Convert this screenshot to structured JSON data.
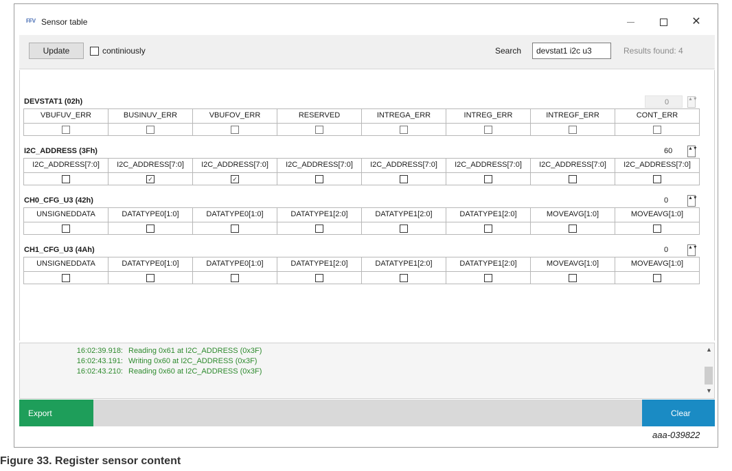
{
  "window": {
    "title": "Sensor table",
    "app_icon_text": "FFV"
  },
  "toolbar": {
    "update_label": "Update",
    "continuously_label": "continiously",
    "search_label": "Search",
    "search_value": "devstat1 i2c u3",
    "results_text": "Results found: 4"
  },
  "registers": [
    {
      "name": "DEVSTAT1 (02h)",
      "value": "0",
      "disabled": true,
      "bits": [
        "VBUFUV_ERR",
        "BUSINUV_ERR",
        "VBUFOV_ERR",
        "RESERVED",
        "INTREGA_ERR",
        "INTREG_ERR",
        "INTREGF_ERR",
        "CONT_ERR"
      ],
      "checked": [
        false,
        false,
        false,
        false,
        false,
        false,
        false,
        false
      ]
    },
    {
      "name": "I2C_ADDRESS (3Fh)",
      "value": "60",
      "disabled": false,
      "bits": [
        "I2C_ADDRESS[7:0]",
        "I2C_ADDRESS[7:0]",
        "I2C_ADDRESS[7:0]",
        "I2C_ADDRESS[7:0]",
        "I2C_ADDRESS[7:0]",
        "I2C_ADDRESS[7:0]",
        "I2C_ADDRESS[7:0]",
        "I2C_ADDRESS[7:0]"
      ],
      "checked": [
        false,
        true,
        true,
        false,
        false,
        false,
        false,
        false
      ]
    },
    {
      "name": "CH0_CFG_U3 (42h)",
      "value": "0",
      "disabled": false,
      "bits": [
        "UNSIGNEDDATA",
        "DATATYPE0[1:0]",
        "DATATYPE0[1:0]",
        "DATATYPE1[2:0]",
        "DATATYPE1[2:0]",
        "DATATYPE1[2:0]",
        "MOVEAVG[1:0]",
        "MOVEAVG[1:0]"
      ],
      "checked": [
        false,
        false,
        false,
        false,
        false,
        false,
        false,
        false
      ]
    },
    {
      "name": "CH1_CFG_U3 (4Ah)",
      "value": "0",
      "disabled": false,
      "bits": [
        "UNSIGNEDDATA",
        "DATATYPE0[1:0]",
        "DATATYPE0[1:0]",
        "DATATYPE1[2:0]",
        "DATATYPE1[2:0]",
        "DATATYPE1[2:0]",
        "MOVEAVG[1:0]",
        "MOVEAVG[1:0]"
      ],
      "checked": [
        false,
        false,
        false,
        false,
        false,
        false,
        false,
        false
      ]
    }
  ],
  "log": [
    {
      "time": "16:02:39.918:",
      "message": "Reading 0x61 at I2C_ADDRESS (0x3F)"
    },
    {
      "time": "16:02:43.191:",
      "message": "Writing 0x60 at I2C_ADDRESS (0x3F)"
    },
    {
      "time": "16:02:43.210:",
      "message": "Reading 0x60 at I2C_ADDRESS (0x3F)"
    }
  ],
  "bottombar": {
    "export_label": "Export",
    "clear_label": "Clear"
  },
  "figure": {
    "id": "aaa-039822",
    "caption": "Figure 33.  Register sensor content"
  },
  "colors": {
    "export_bg": "#1e9e5a",
    "clear_bg": "#1a8bc4",
    "log_text": "#2d8a2d"
  }
}
